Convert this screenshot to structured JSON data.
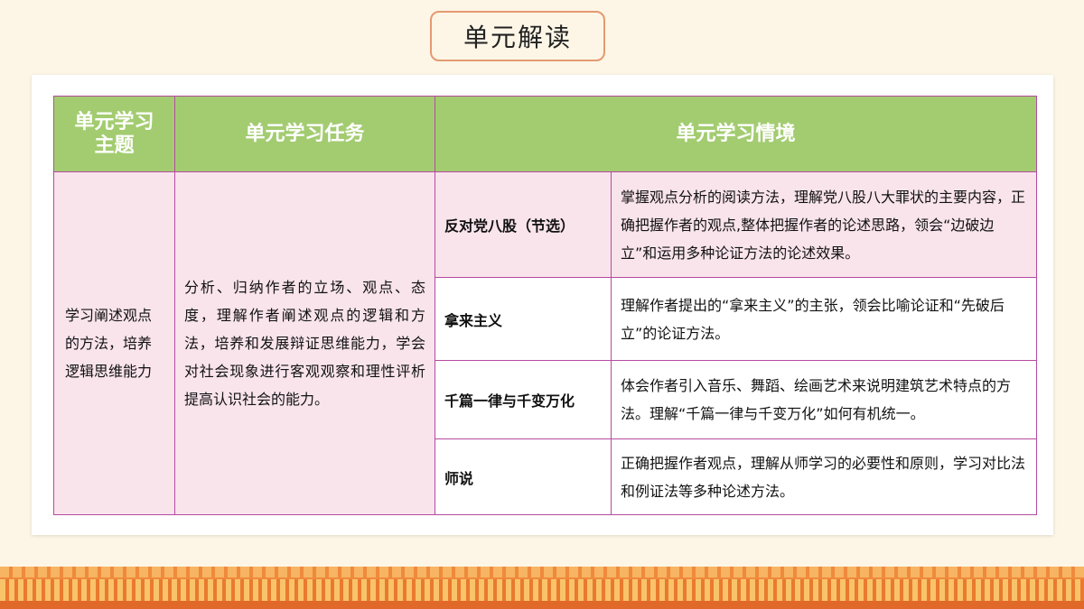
{
  "slide_title": "单元解读",
  "table": {
    "headers": {
      "theme": "单元学习主题",
      "task": "单元学习任务",
      "context": "单元学习情境"
    },
    "theme": "学习阐述观点的方法，培养逻辑思维能力",
    "task": "分析、归纳作者的立场、观点、态度，理解作者阐述观点的逻辑和方法，培养和发展辩证思维能力，学会对社会现象进行客观观察和理性评析提高认识社会的能力。",
    "rows": [
      {
        "name": "反对党八股（节选）",
        "text": "掌握观点分析的阅读方法，理解党八股八大罪状的主要内容，正确把握作者的观点,整体把握作者的论述思路，领会“边破边立”和运用多种论证方法的论述效果。"
      },
      {
        "name": "拿来主义",
        "text": "理解作者提出的“拿来主义”的主张，领会比喻论证和“先破后立”的论证方法。"
      },
      {
        "name": "千篇一律与千变万化",
        "text": "体会作者引入音乐、舞蹈、绘画艺术来说明建筑艺术特点的方法。理解“千篇一律与千变万化”如何有机统一。"
      },
      {
        "name": "师说",
        "text": "正确把握作者观点，理解从师学习的必要性和原则，学习对比法和例证法等多种论述方法。"
      }
    ]
  },
  "colors": {
    "header_green": "#a3cc71",
    "cell_pink": "#f9e4ec",
    "border_magenta": "#b54aa1",
    "title_border": "#e39a72",
    "background": "#fdf6e6"
  }
}
